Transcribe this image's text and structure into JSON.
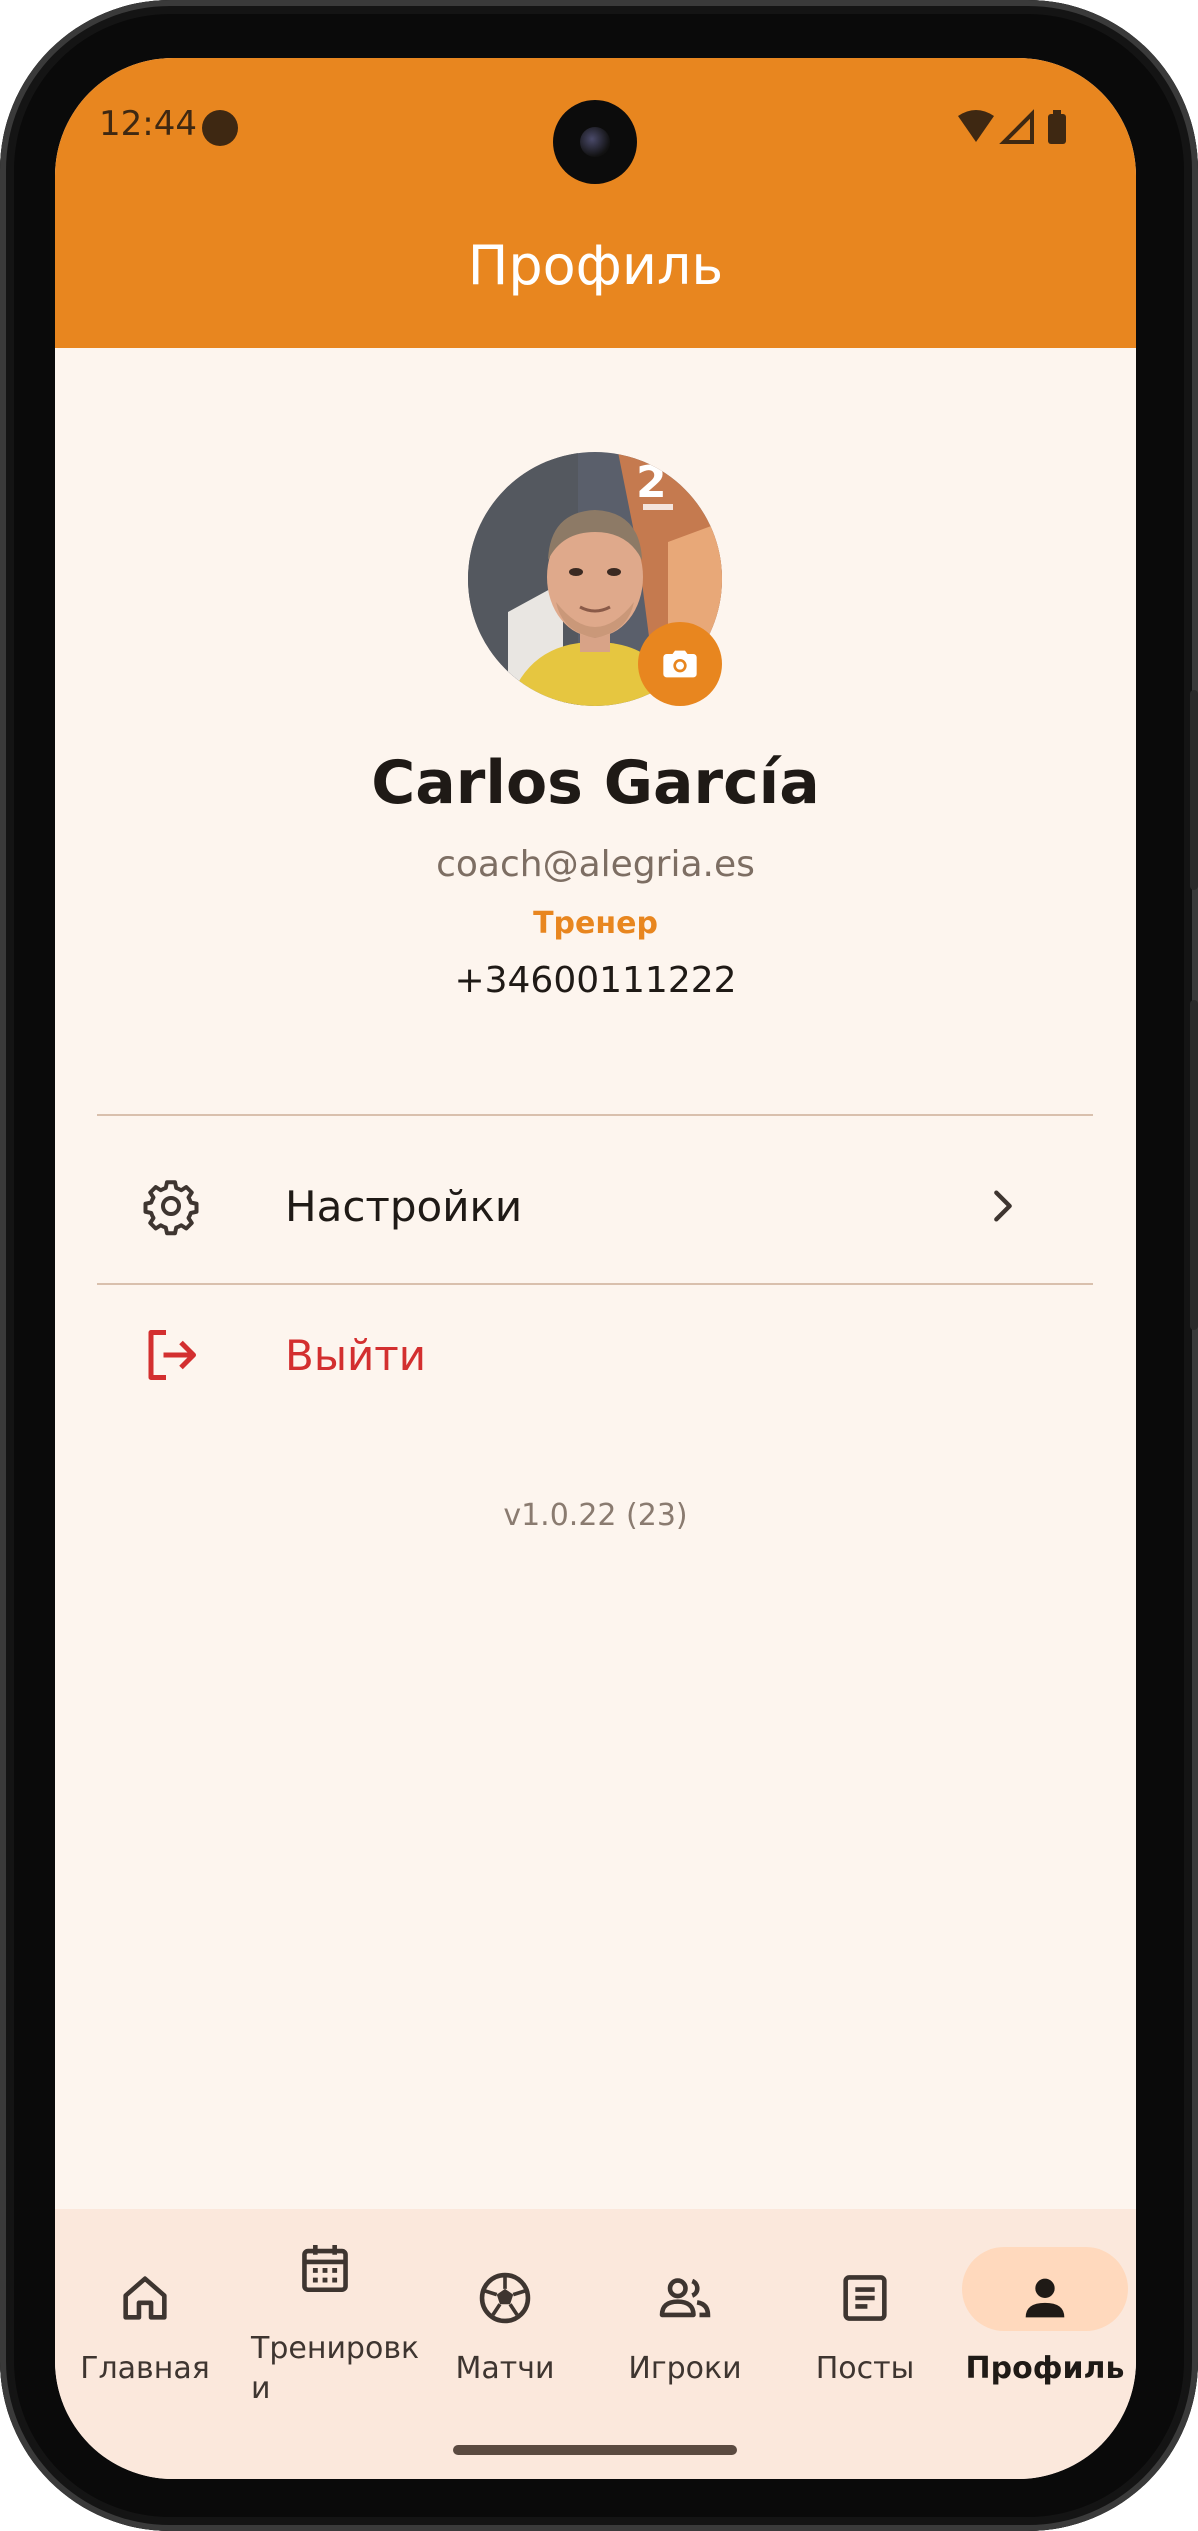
{
  "status_bar": {
    "time": "12:44"
  },
  "appbar": {
    "title": "Профиль"
  },
  "profile": {
    "name": "Carlos García",
    "email": "coach@alegria.es",
    "role": "Тренер",
    "phone": "+34600111222"
  },
  "menu": {
    "settings_label": "Настройки",
    "logout_label": "Выйти"
  },
  "version": "v1.0.22 (23)",
  "bottom_nav": {
    "items": [
      {
        "label": "Главная",
        "icon": "home-icon"
      },
      {
        "label": "Тренировк\nи",
        "icon": "calendar-icon"
      },
      {
        "label": "Матчи",
        "icon": "soccer-ball-icon"
      },
      {
        "label": "Игроки",
        "icon": "people-icon"
      },
      {
        "label": "Посты",
        "icon": "article-icon"
      },
      {
        "label": "Профиль",
        "icon": "person-icon"
      }
    ],
    "active_index": 5
  },
  "colors": {
    "accent": "#e8861f",
    "background": "#fdf5ee",
    "logout": "#d32f2f",
    "nav_background": "#fbe8dc"
  }
}
